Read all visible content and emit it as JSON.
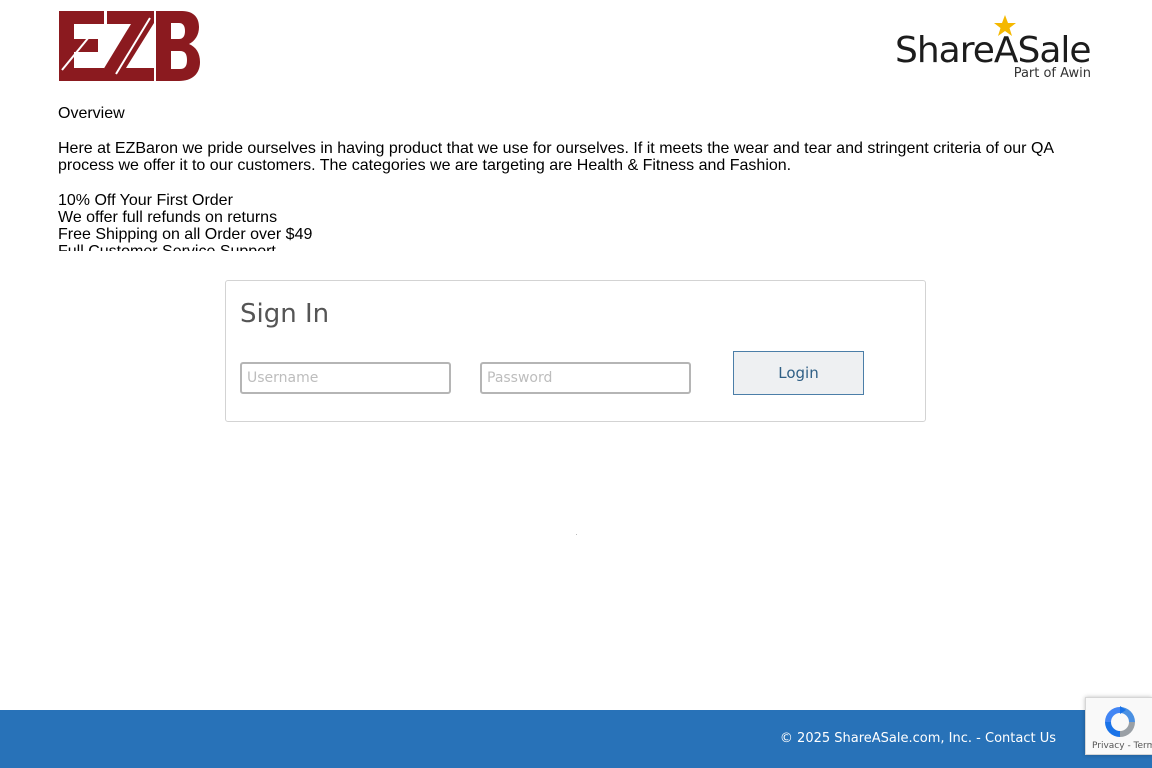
{
  "header": {
    "brand_logo_icon": "ezb-logo",
    "partner_logo_icon": "shareasale-logo",
    "partner_logo_text": "ShareASale",
    "partner_logo_subtext": "Part of Awin",
    "colors": {
      "ezb_red": "#8b1a1f",
      "star_yellow": "#f5b800"
    }
  },
  "overview": {
    "title": "Overview",
    "body": "Here at EZBaron we pride ourselves in having product that we use for ourselves. If it meets the wear and tear and stringent criteria of our QA process we offer it to our customers. The categories we are targeting are Health & Fitness and Fashion.",
    "perks": [
      "10% Off Your First Order",
      "We offer full refunds on returns",
      "Free Shipping on all Order over $49",
      "Full Customer Service Support"
    ]
  },
  "signin": {
    "title": "Sign In",
    "username_placeholder": "Username",
    "username_value": "",
    "password_placeholder": "Password",
    "password_value": "",
    "login_label": "Login"
  },
  "footer": {
    "copyright": "© 2025 ShareASale.com, Inc. -",
    "contact_label": "Contact Us",
    "background": "#2872b8"
  },
  "recaptcha": {
    "icon": "recaptcha-icon",
    "links": "Privacy - Terms"
  }
}
